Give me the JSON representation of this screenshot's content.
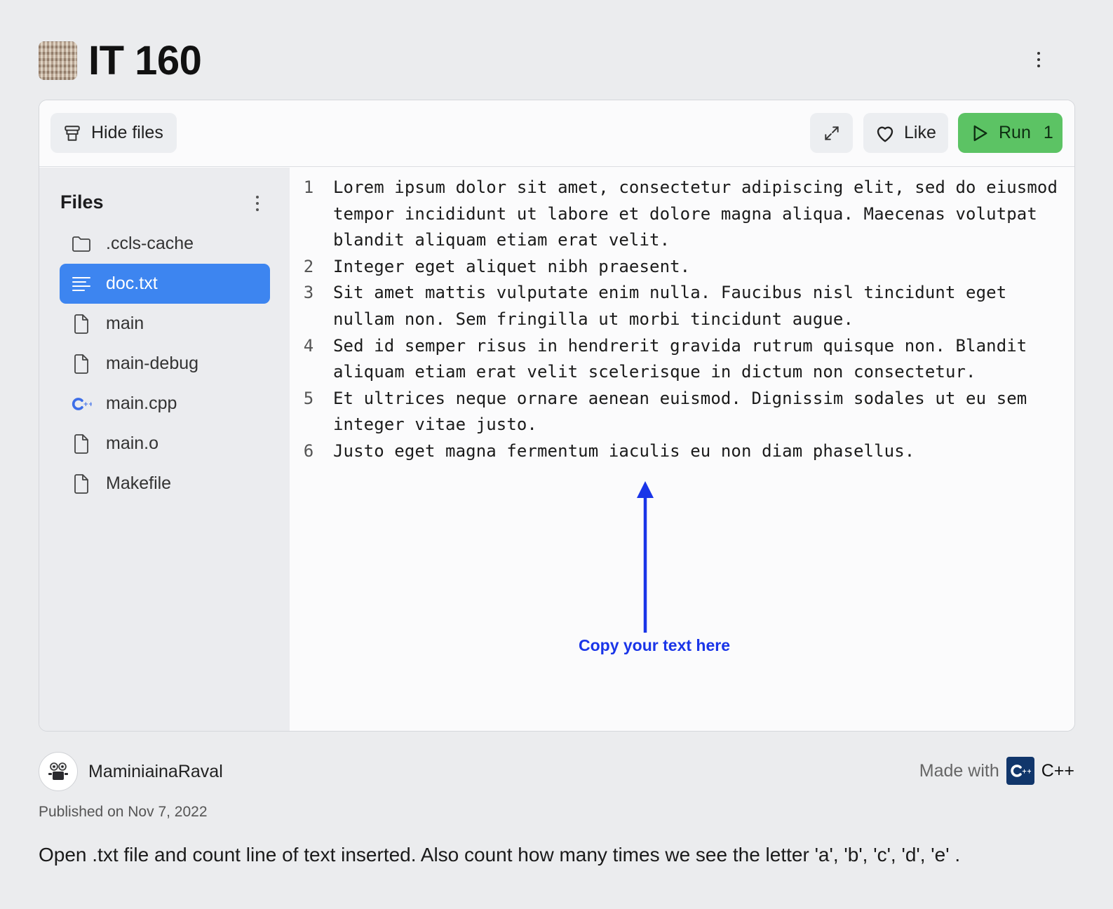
{
  "repl": {
    "title": "IT 160"
  },
  "toolbar": {
    "hide_files_label": "Hide files",
    "like_label": "Like",
    "run_label": "Run",
    "run_count": "1"
  },
  "sidebar": {
    "heading": "Files",
    "files": [
      {
        "name": ".ccls-cache",
        "icon": "folder-icon"
      },
      {
        "name": "doc.txt",
        "icon": "text-file-icon",
        "selected": true
      },
      {
        "name": "main",
        "icon": "file-icon"
      },
      {
        "name": "main-debug",
        "icon": "file-icon"
      },
      {
        "name": "main.cpp",
        "icon": "cpp-icon"
      },
      {
        "name": "main.o",
        "icon": "file-icon"
      },
      {
        "name": "Makefile",
        "icon": "file-icon"
      }
    ]
  },
  "editor": {
    "lines": [
      {
        "number": "1",
        "text": "Lorem ipsum dolor sit amet, consectetur adipiscing elit, sed do eiusmod tempor incididunt ut labore et dolore magna aliqua. Maecenas volutpat blandit aliquam etiam erat velit."
      },
      {
        "number": "2",
        "text": "Integer eget aliquet nibh praesent."
      },
      {
        "number": "3",
        "text": "Sit amet mattis vulputate enim nulla. Faucibus nisl tincidunt eget nullam non. Sem fringilla ut morbi tincidunt augue."
      },
      {
        "number": "4",
        "text": "Sed id semper risus in hendrerit gravida rutrum quisque non. Blandit aliquam etiam erat velit scelerisque in dictum non consectetur."
      },
      {
        "number": "5",
        "text": "Et ultrices neque ornare aenean euismod. Dignissim sodales ut eu sem integer vitae justo."
      },
      {
        "number": "6",
        "text": "Justo eget magna fermentum iaculis eu non diam phasellus."
      }
    ],
    "annotation": "Copy your text here"
  },
  "footer": {
    "author": "MaminiainaRaval",
    "made_with_prefix": "Made with",
    "language": "C++",
    "published": "Published on Nov 7, 2022",
    "description": "Open .txt file and count line of text inserted. Also count how many times we see the letter 'a', 'b', 'c', 'd', 'e' ."
  },
  "colors": {
    "accent_blue": "#3d85f0",
    "run_green": "#5cc364",
    "annotation_blue": "#1a35e8"
  }
}
